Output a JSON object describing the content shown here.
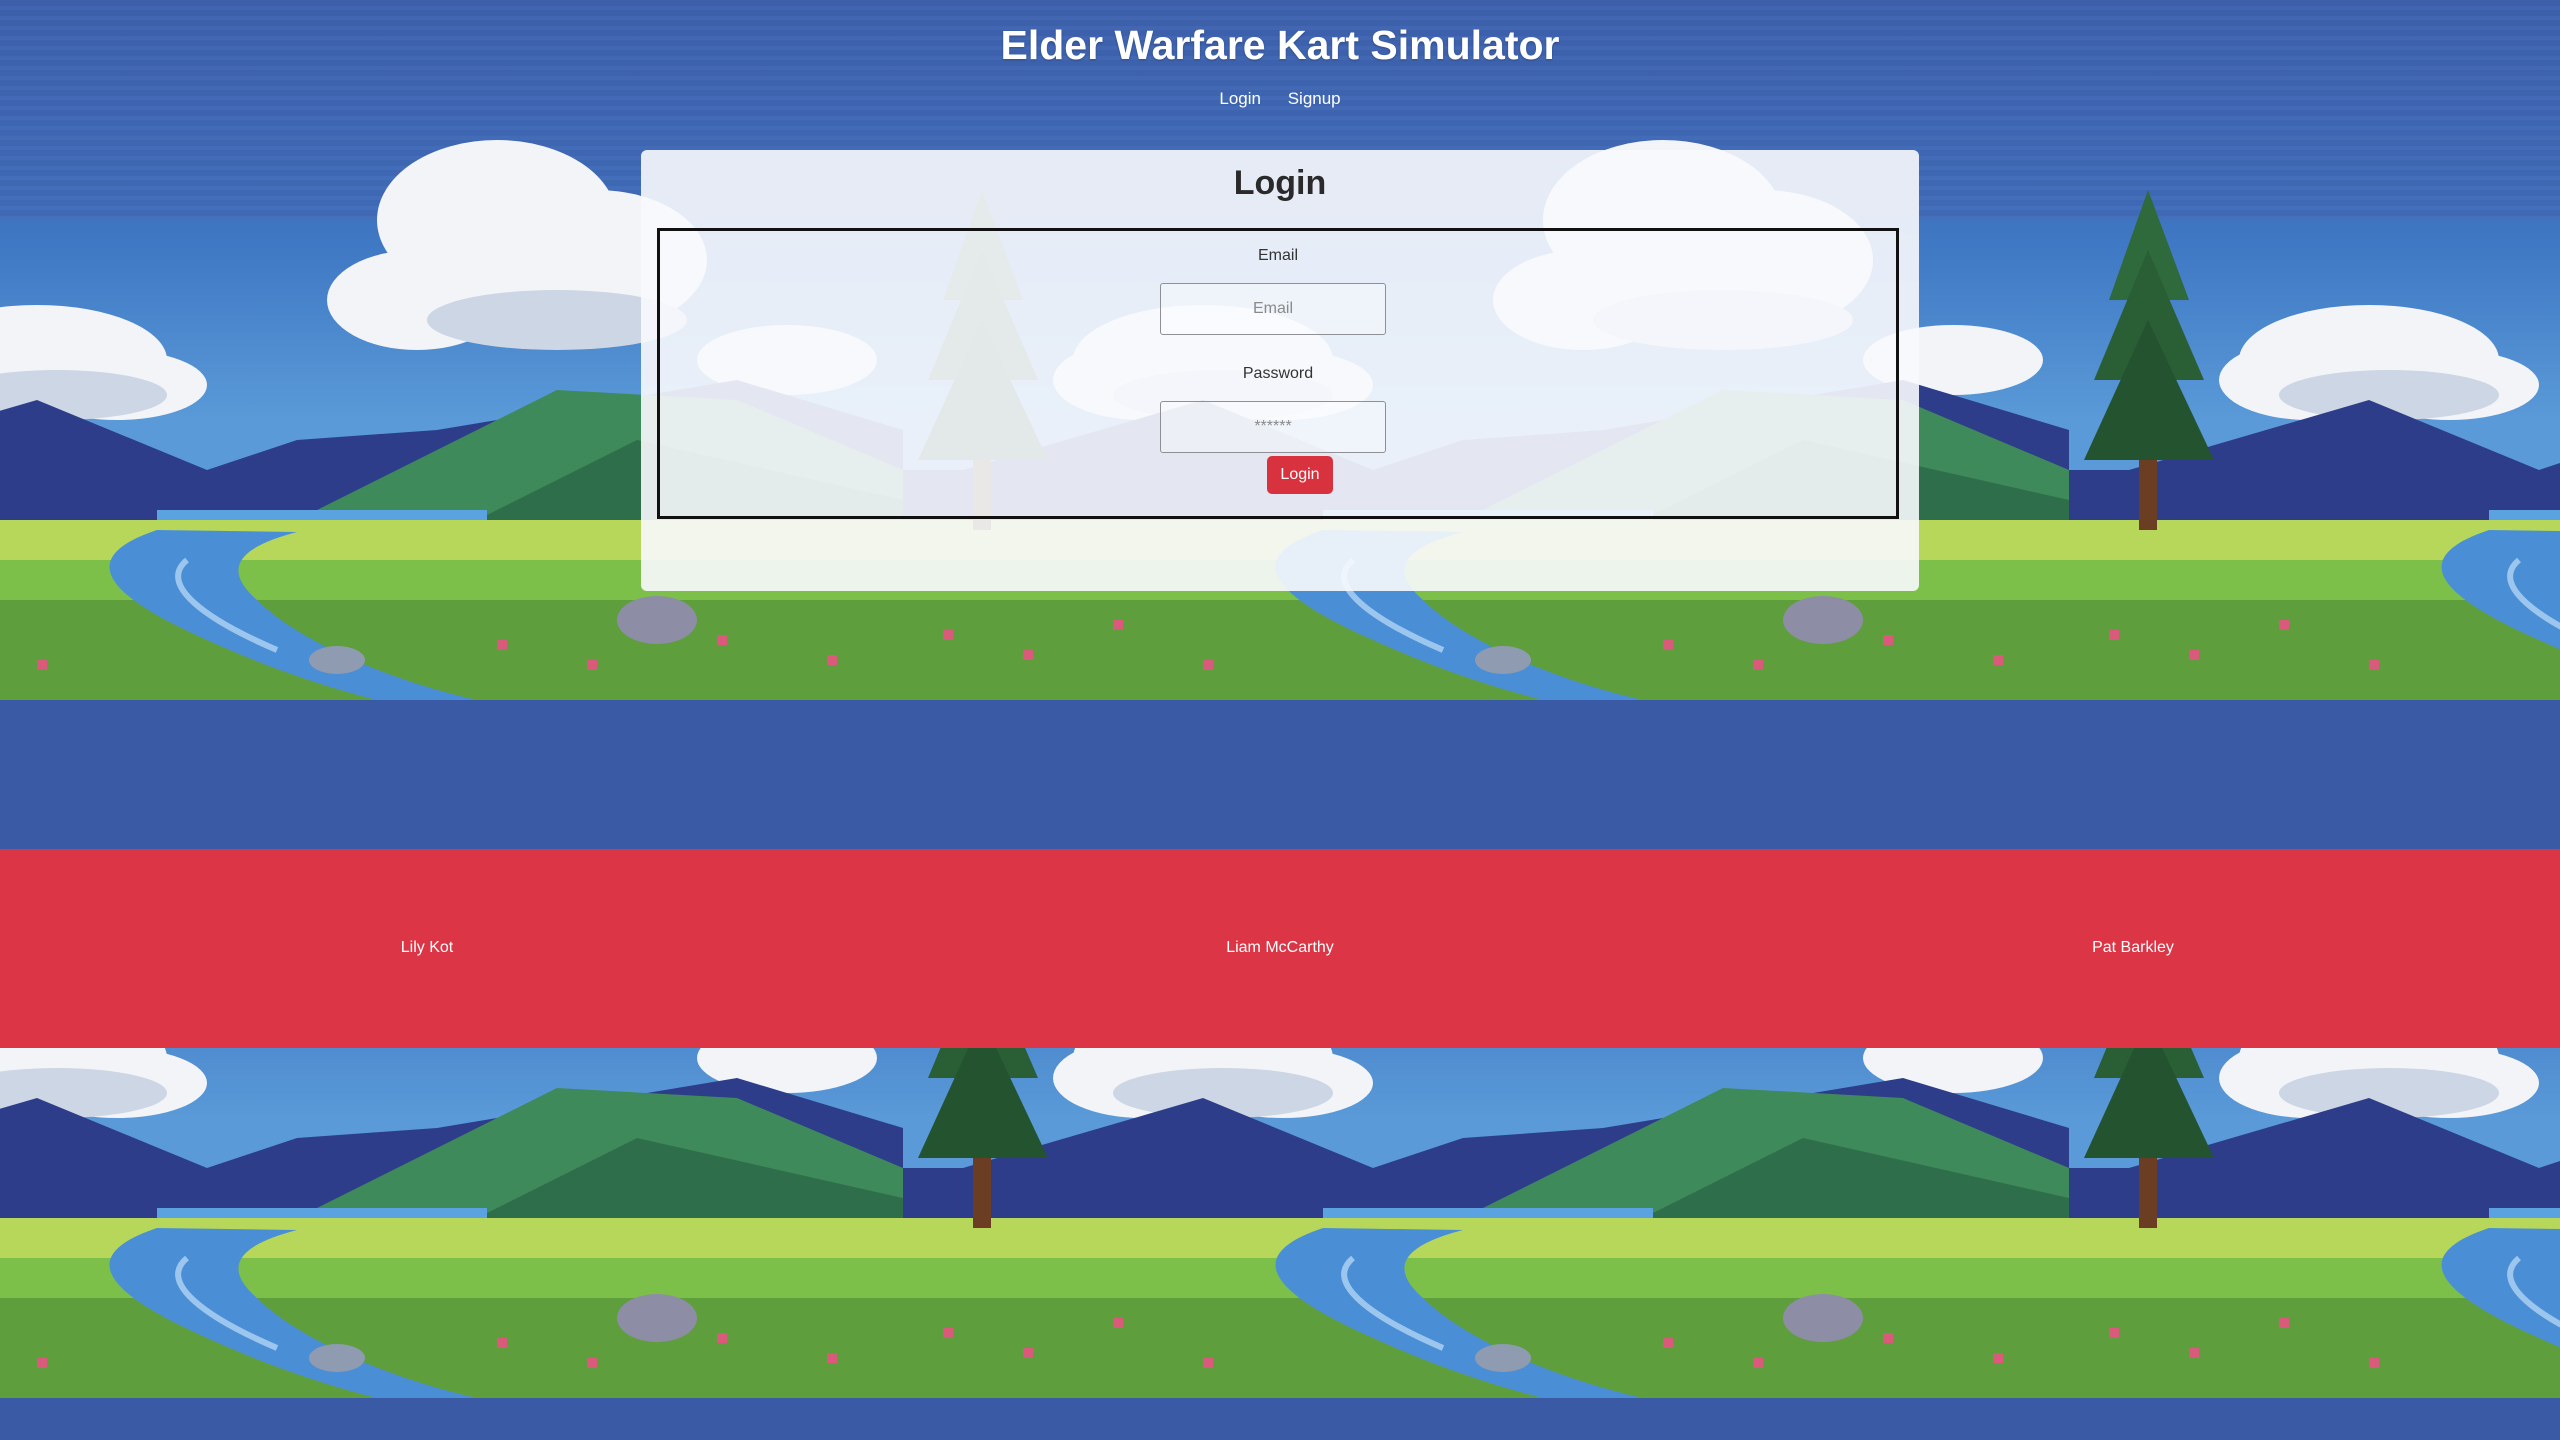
{
  "header": {
    "title": "Elder Warfare Kart Simulator",
    "nav": {
      "login": "Login",
      "signup": "Signup"
    }
  },
  "login_card": {
    "title": "Login",
    "email": {
      "label": "Email",
      "placeholder": "Email",
      "value": ""
    },
    "password": {
      "label": "Password",
      "placeholder": "******",
      "value": ""
    },
    "submit_label": "Login"
  },
  "footer": {
    "credits": [
      "Lily Kot",
      "Liam McCarthy",
      "Pat Barkley"
    ]
  },
  "colors": {
    "page_bg": "#3a5aa6",
    "accent_red": "#dc3545",
    "button_red": "#d9323f",
    "sky": "#3e7fc8",
    "grass": "#7cc04a"
  }
}
